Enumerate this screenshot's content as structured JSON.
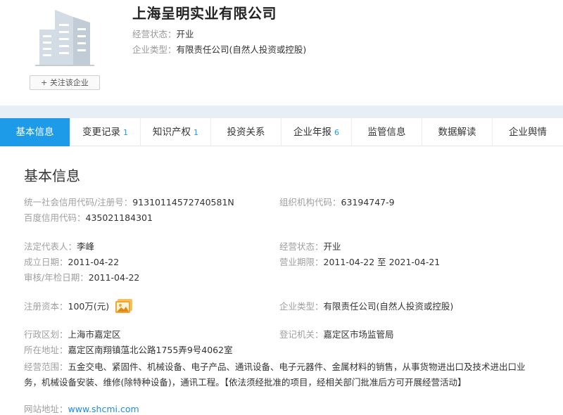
{
  "company": {
    "name": "上海呈明实业有限公司",
    "status_label": "经营状态：",
    "status_value": "开业",
    "type_label": "企业类型：",
    "type_value": "有限责任公司(自然人投资或控股)",
    "follow_label": "+ 关注该企业"
  },
  "tabs": [
    {
      "label": "基本信息",
      "count": "",
      "active": true
    },
    {
      "label": "变更记录",
      "count": "1"
    },
    {
      "label": "知识产权",
      "count": "1"
    },
    {
      "label": "投资关系",
      "count": ""
    },
    {
      "label": "企业年报",
      "count": "6"
    },
    {
      "label": "监管信息",
      "count": ""
    },
    {
      "label": "数据解读",
      "count": ""
    },
    {
      "label": "企业舆情",
      "count": ""
    }
  ],
  "basic": {
    "title": "基本信息",
    "credit_code_label": "统一社会信用代码/注册号：",
    "credit_code": "91310114572740581N",
    "org_code_label": "组织机构代码：",
    "org_code": "63194747-9",
    "baidu_code_label": "百度信用代码：",
    "baidu_code": "435021184301",
    "legal_rep_label": "法定代表人：",
    "legal_rep": "李峰",
    "biz_status_label": "经营状态：",
    "biz_status": "开业",
    "established_label": "成立日期：",
    "established": "2011-04-22",
    "term_label": "营业期限：",
    "term": "2011-04-22 至 2021-04-21",
    "approval_label": "审核/年检日期：",
    "approval": "2011-04-22",
    "capital_label": "注册资本：",
    "capital": "100万(元)",
    "type_label": "企业类型：",
    "type": "有限责任公司(自然人投资或控股)",
    "district_label": "行政区划：",
    "district": "上海市嘉定区",
    "authority_label": "登记机关：",
    "authority": "嘉定区市场监管局",
    "address_label": "所在地址：",
    "address": "嘉定区南翔镇蕰北公路1755弄9号4062室",
    "scope_label": "经营范围：",
    "scope": "五金交电、紧固件、机械设备、电子产品、通讯设备、电子元器件、金属材料的销售，从事货物进出口及技术进出口业务，机械设备安装、维修(除特种设备)，通讯工程。【依法须经批准的项目，经相关部门批准后方可开展经营活动】",
    "website_label": "网站地址：",
    "website": "www.shcmi.com"
  },
  "colors": {
    "accent": "#1e9be8",
    "band": "#e8eef6",
    "label_gray": "#a0a0a0",
    "logo_gray": "#c9d3de",
    "image_icon": "#f3a530"
  },
  "icons": [
    "building-logo-icon",
    "image-icon"
  ]
}
